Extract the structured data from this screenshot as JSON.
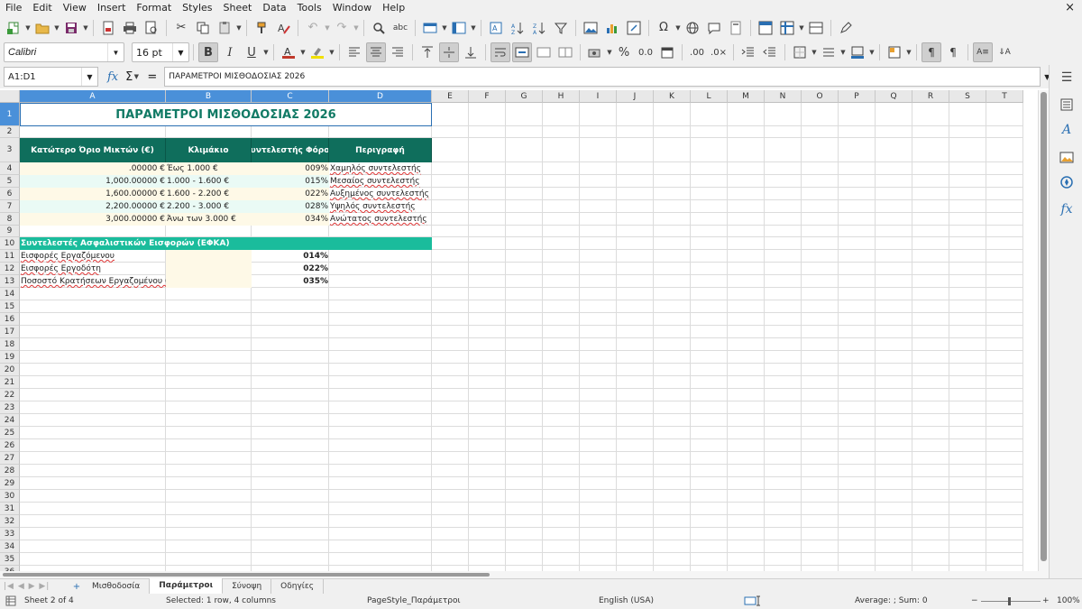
{
  "menu": [
    "File",
    "Edit",
    "View",
    "Insert",
    "Format",
    "Styles",
    "Sheet",
    "Data",
    "Tools",
    "Window",
    "Help"
  ],
  "window": {
    "close_label": "×"
  },
  "font": {
    "name": "Calibri",
    "size": "16 pt"
  },
  "formula_bar": {
    "name_box": "A1:D1",
    "fx_label": "fx",
    "sigma_label": "Σ",
    "equals_label": "=",
    "content": "ΠΑΡΑΜΕΤΡΟΙ ΜΙΣΘΟΔΟΣΙΑΣ 2026"
  },
  "columns": [
    "A",
    "B",
    "C",
    "D",
    "E",
    "F",
    "G",
    "H",
    "I",
    "J",
    "K",
    "L",
    "M",
    "N",
    "O",
    "P",
    "Q",
    "R",
    "S",
    "T"
  ],
  "rows": [
    "1",
    "2",
    "3",
    "4",
    "5",
    "6",
    "7",
    "8",
    "9",
    "10",
    "11",
    "12",
    "13",
    "14",
    "15",
    "16",
    "17",
    "18",
    "19",
    "20",
    "21",
    "22",
    "23",
    "24",
    "25",
    "26",
    "27",
    "28",
    "29",
    "30",
    "31",
    "32",
    "33",
    "34",
    "35",
    "36"
  ],
  "sheet": {
    "title": "ΠΑΡΑΜΕΤΡΟΙ ΜΙΣΘΟΔΟΣΙΑΣ 2026",
    "headers": [
      "Κατώτερο Όριο Μικτών (€)",
      "Κλιμάκιο",
      "Συντελεστής Φόρου",
      "Περιγραφή"
    ],
    "tax_rows": [
      {
        "lower": ".00000 €",
        "bracket": "Έως 1.000 €",
        "rate": "009%",
        "desc": "Χαμηλός συντελεστής"
      },
      {
        "lower": "1,000.00000 €",
        "bracket": "1.000 - 1.600 €",
        "rate": "015%",
        "desc": "Μεσαίος συντελεστής"
      },
      {
        "lower": "1,600.00000 €",
        "bracket": "1.600 - 2.200 €",
        "rate": "022%",
        "desc": "Αυξημένος συντελεστής"
      },
      {
        "lower": "2,200.00000 €",
        "bracket": "2.200 - 3.000 €",
        "rate": "028%",
        "desc": "Υψηλός συντελεστής"
      },
      {
        "lower": "3,000.00000 €",
        "bracket": "Άνω των 3.000 €",
        "rate": "034%",
        "desc": "Ανώτατος συντελεστής"
      }
    ],
    "efka_header": "Συντελεστές Ασφαλιστικών Εισφορών (ΕΦΚΑ)",
    "efka_rows": [
      {
        "label": "Εισφορές Εργαζόμενου",
        "value": "014%"
      },
      {
        "label": "Εισφορές Εργοδότη",
        "value": "022%"
      },
      {
        "label": "Ποσοστό Κρατήσεων Εργαζομένου (ελ",
        "value": "035%"
      }
    ]
  },
  "tabs": {
    "add_label": "+",
    "nav_label": "|◀ ◀ ▶ ▶|",
    "items": [
      "Μισθοδοσία",
      "Παράμετροι",
      "Σύνοψη",
      "Οδηγίες"
    ],
    "active": "Παράμετροι"
  },
  "status": {
    "sheet": "Sheet 2 of 4",
    "selection": "Selected: 1 row, 4 columns",
    "page_style": "PageStyle_Παράμετροι",
    "language": "English (USA)",
    "summary": "Average: ; Sum: 0",
    "zoom": "100%",
    "zoom_out_label": "−",
    "zoom_in_label": "+"
  },
  "colors": {
    "header_bg": "#0f6e5c",
    "subheader_bg": "#1abc9c",
    "title_text": "#117a65",
    "selection": "#4a90d9"
  }
}
